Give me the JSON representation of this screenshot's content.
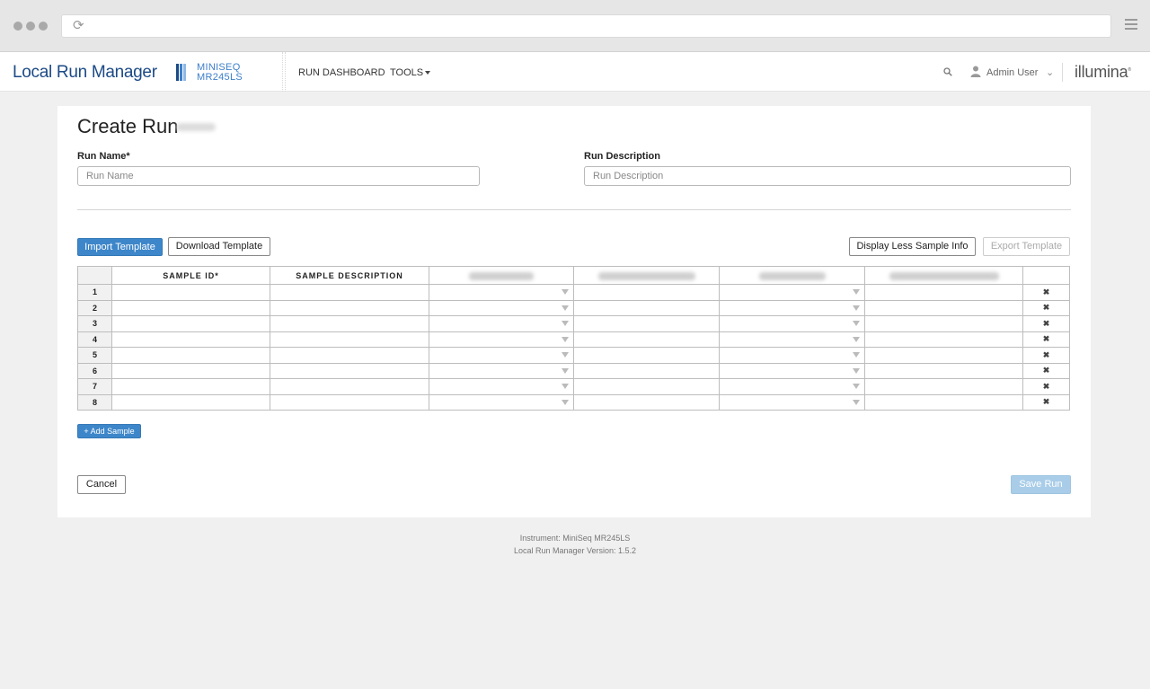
{
  "header": {
    "app_title": "Local Run Manager",
    "instrument_line1": "MINISEQ",
    "instrument_line2": "MR245LS",
    "nav_dashboard": "RUN DASHBOARD",
    "nav_tools": "TOOLS",
    "user_name": "Admin User",
    "brand": "illumina",
    "bar_colors": [
      "#1c4a86",
      "#3d7fc9",
      "#8fb8e6"
    ]
  },
  "page": {
    "title": "Create Run",
    "run_name_label": "Run Name*",
    "run_name_placeholder": "Run Name",
    "run_desc_label": "Run Description",
    "run_desc_placeholder": "Run Description"
  },
  "toolbar": {
    "import_label": "Import Template",
    "download_label": "Download Template",
    "display_less_label": "Display Less Sample Info",
    "export_label": "Export Template"
  },
  "table": {
    "headers": [
      "SAMPLE ID*",
      "SAMPLE DESCRIPTION"
    ],
    "rows": [
      "1",
      "2",
      "3",
      "4",
      "5",
      "6",
      "7",
      "8"
    ],
    "delete_glyph": "✖"
  },
  "actions": {
    "add_sample_label": "+ Add Sample",
    "cancel_label": "Cancel",
    "save_label": "Save Run"
  },
  "footer": {
    "instrument": "Instrument: MiniSeq MR245LS",
    "version": "Local Run Manager Version: 1.5.2"
  },
  "colors": {
    "primary": "#3d86c9",
    "brand_blue": "#1c4a86",
    "save_disabled": "#a9cde8"
  }
}
